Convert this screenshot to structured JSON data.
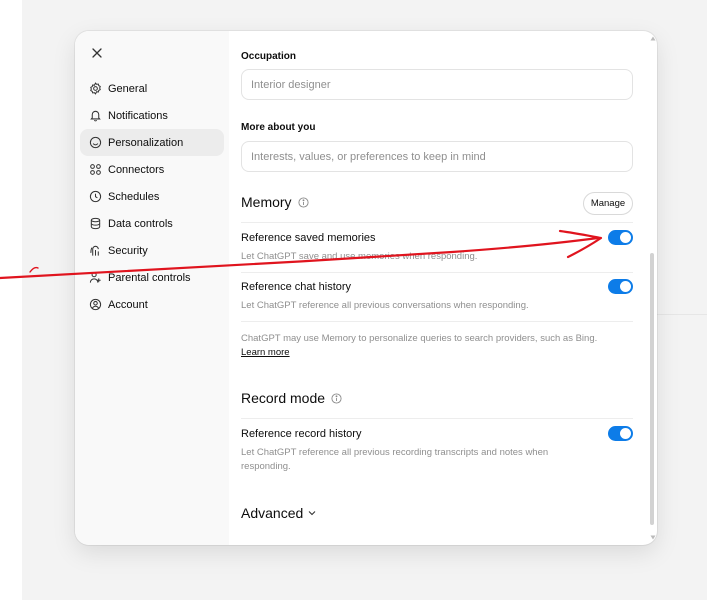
{
  "sidebar": {
    "items": [
      {
        "label": "General",
        "icon": "gear-icon"
      },
      {
        "label": "Notifications",
        "icon": "bell-icon"
      },
      {
        "label": "Personalization",
        "icon": "personalization-icon"
      },
      {
        "label": "Connectors",
        "icon": "connectors-icon"
      },
      {
        "label": "Schedules",
        "icon": "clock-icon"
      },
      {
        "label": "Data controls",
        "icon": "database-icon"
      },
      {
        "label": "Security",
        "icon": "security-icon"
      },
      {
        "label": "Parental controls",
        "icon": "parental-icon"
      },
      {
        "label": "Account",
        "icon": "account-icon"
      }
    ],
    "active_index": 2
  },
  "personalization": {
    "occupation_label": "Occupation",
    "occupation_placeholder": "Interior designer",
    "more_label": "More about you",
    "more_placeholder": "Interests, values, or preferences to keep in mind"
  },
  "memory": {
    "title": "Memory",
    "manage_label": "Manage",
    "saved_title": "Reference saved memories",
    "saved_desc": "Let ChatGPT save and use memories when responding.",
    "saved_on": true,
    "chat_title": "Reference chat history",
    "chat_desc": "Let ChatGPT reference all previous conversations when responding.",
    "chat_on": true,
    "note": "ChatGPT may use Memory to personalize queries to search providers, such as Bing.",
    "learn_more": "Learn more"
  },
  "record": {
    "title": "Record mode",
    "history_title": "Reference record history",
    "history_desc": "Let ChatGPT reference all previous recording transcripts and notes when responding.",
    "history_on": true
  },
  "advanced_label": "Advanced",
  "colors": {
    "toggle_on": "#0d7ce8",
    "annotation": "#e0141e"
  }
}
